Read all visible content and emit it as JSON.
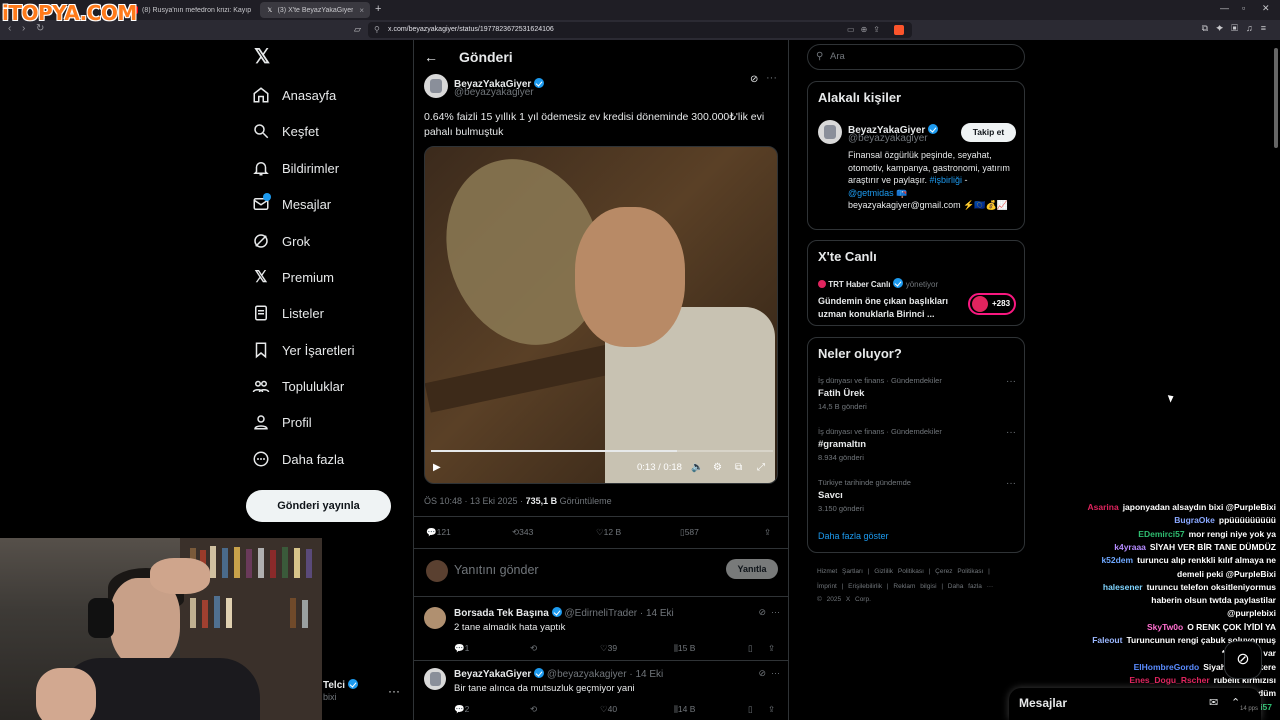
{
  "watermark": "iTOPYA.COM",
  "browser": {
    "tabs": [
      {
        "label": "(8) Rusya'nın mefedron krizi: Kayıp g...",
        "icon": "youtube-icon",
        "color": "#ff0000"
      },
      {
        "label": "(3) X'te BeyazYakaGiyer: \"0.64%...",
        "icon": "x-icon",
        "color": "#ffffff"
      }
    ],
    "url": "x.com/beyazyakagiyer/status/1977823672531624106"
  },
  "sidebar": {
    "items": [
      {
        "label": "Anasayfa",
        "icon": "home-icon"
      },
      {
        "label": "Keşfet",
        "icon": "search-icon"
      },
      {
        "label": "Bildirimler",
        "icon": "bell-icon"
      },
      {
        "label": "Mesajlar",
        "icon": "mail-icon"
      },
      {
        "label": "Grok",
        "icon": "grok-icon"
      },
      {
        "label": "Premium",
        "icon": "x-icon"
      },
      {
        "label": "Listeler",
        "icon": "list-icon"
      },
      {
        "label": "Yer İşaretleri",
        "icon": "bookmark-icon"
      },
      {
        "label": "Topluluklar",
        "icon": "communities-icon"
      },
      {
        "label": "Profil",
        "icon": "profile-icon"
      },
      {
        "label": "Daha fazla",
        "icon": "more-circle-icon"
      }
    ],
    "post_button": "Gönderi yayınla",
    "profile": {
      "name": "Telci",
      "handle": "bixi"
    }
  },
  "main": {
    "header_title": "Gönderi",
    "post": {
      "name": "BeyazYakaGiyer",
      "handle": "@beyazyakagiyer",
      "text": "0.64% faizli 15 yıllık 1 yıl ödemesiz ev kredisi döneminde 300.000₺'lik evi pahalı bulmuştuk",
      "video": {
        "time": "0:13 / 0:18",
        "progress": 0.72
      },
      "time": "ÖS 10:48 · 13 Eki 2025 · ",
      "views": "735,1 B",
      "views_label": " Görüntüleme",
      "stats": {
        "replies": "121",
        "reposts": "343",
        "likes": "12 B",
        "bookmarks": "587"
      }
    },
    "reply_placeholder": "Yanıtını gönder",
    "reply_button": "Yanıtla",
    "replies": [
      {
        "name": "Borsada Tek Başına",
        "handle": "@EdirneliTrader · 14 Eki",
        "text": "2 tane almadık hata yaptık",
        "stats": {
          "replies": "1",
          "reposts": "",
          "likes": "39",
          "views": "15 B"
        }
      },
      {
        "name": "BeyazYakaGiyer",
        "handle": "@beyazyakagiyer · 14 Eki",
        "text": "Bir tane alınca da mutsuzluk geçmiyor yani",
        "stats": {
          "replies": "2",
          "reposts": "",
          "likes": "40",
          "views": "14 B"
        }
      }
    ]
  },
  "right": {
    "search_placeholder": "Ara",
    "related": {
      "title": "Alakalı kişiler",
      "name": "BeyazYakaGiyer",
      "handle": "@beyazyakagiyer",
      "follow": "Takip et",
      "bio_1": "Finansal özgürlük peşinde, seyahat, otomotiv, kampanya, gastronomi, yatırım araştırır ve paylaşır. ",
      "bio_link1": "#işbirliği",
      "bio_dash": " - ",
      "bio_link2": "@getmidas",
      "bio_2": " 📪 beyazyakagiyer@gmail.com ⚡🇪🇺💰📈"
    },
    "live": {
      "title": "X'te Canlı",
      "host": "TRT Haber Canlı",
      "host_suffix": " yönetiyor",
      "desc": "Gündemin öne çıkan başlıkları uzman konuklarla Birinci ...",
      "count": "+283"
    },
    "trends": {
      "title": "Neler oluyor?",
      "items": [
        {
          "cat": "İş dünyası ve finans · Gündemdekiler",
          "name": "Fatih Ürek",
          "posts": "14,5 B gönderi"
        },
        {
          "cat": "İş dünyası ve finans · Gündemdekiler",
          "name": "#gramaltın",
          "posts": "8.934 gönderi"
        },
        {
          "cat": "Türkiye tarihinde gündemde",
          "name": "Savcı",
          "posts": "3.150 gönderi"
        }
      ],
      "show_more": "Daha fazla göster"
    },
    "footer_1": "Hizmet Şartları | Gizlilik Politikası | Çerez Politikası |",
    "footer_2": "İmprint | Erişilebilirlik | Reklam bilgisi | Daha fazla ···",
    "footer_3": "© 2025 X Corp."
  },
  "chat": [
    {
      "user": "Asarina",
      "msg": "japonyadan alsaydın bixi @PurpleBixi",
      "color": "#e0245e"
    },
    {
      "user": "BugraOke",
      "msg": "ppüüüüüüüüü",
      "color": "#8aa8ff"
    },
    {
      "user": "EDemirci57",
      "msg": "mor rengi niye yok ya",
      "color": "#2fbf71"
    },
    {
      "user": "k4yraaa",
      "msg": "SİYAH VER BİR TANE DÜMDÜZ",
      "color": "#b58bff"
    },
    {
      "user": "k52dem",
      "msg": "turuncu alıp renkkli kılıf almaya ne",
      "color": "#6fa8ff"
    },
    {
      "user": "",
      "msg": "demeli peki @PurpleBixi",
      "color": "#ffffff"
    },
    {
      "user": "halesener",
      "msg": "turuncu telefon oksitleniyormus",
      "color": "#7fd4ff"
    },
    {
      "user": "",
      "msg": "haberin olsun twtda paylastilar",
      "color": "#ffffff"
    },
    {
      "user": "",
      "msg": "@purplebixi",
      "color": "#ffffff"
    },
    {
      "user": "SkyTw0o",
      "msg": "O RENK ÇOK İYİDİ YA",
      "color": "#ff6fcf"
    },
    {
      "user": "Faleout",
      "msg": "Turuncunun rengi çabuk soluyormuş",
      "color": "#9bb8ff"
    },
    {
      "user": "",
      "msg": "* Videolar var",
      "color": "#ffffff"
    },
    {
      "user": "ElHombreGordo",
      "msg": "Siyah yok bir kere",
      "color": "#5a8cff"
    },
    {
      "user": "Enes_Dogu_Rscher",
      "msg": "rubelit kırmızısı",
      "color": "#e0245e"
    },
    {
      "user": "nepsin",
      "msg": "mürdüm",
      "color": "#ff6fcf"
    },
    {
      "user": "EDemirci57",
      "msg": "",
      "color": "#2fbf71"
    }
  ],
  "messages_bar": "Mesajlar",
  "fps": "14 pps"
}
